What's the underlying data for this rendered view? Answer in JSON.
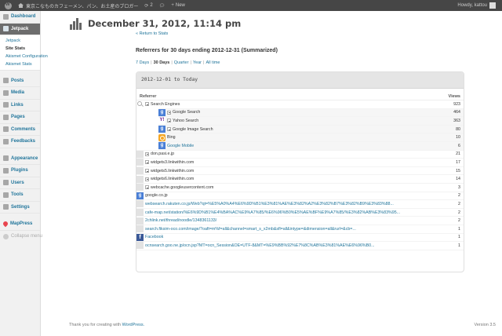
{
  "adminbar": {
    "site_name": "東京こなものカフェーメン、パン、お土産のブロガー",
    "updates_count": "2",
    "new_label": "New",
    "howdy": "Howdy, kattou"
  },
  "sidebar": {
    "items_top": [
      {
        "label": "Dashboard",
        "icon": "dashboard-icon"
      },
      {
        "label": "Jetpack",
        "icon": "jetpack-icon",
        "active": true
      }
    ],
    "submenu": [
      {
        "label": "Jetpack"
      },
      {
        "label": "Site Stats",
        "current": true
      },
      {
        "label": "Akismet Configuration"
      },
      {
        "label": "Akismet Stats"
      }
    ],
    "items_mid": [
      {
        "label": "Posts",
        "icon": "posts-icon"
      },
      {
        "label": "Media",
        "icon": "media-icon"
      },
      {
        "label": "Links",
        "icon": "links-icon"
      },
      {
        "label": "Pages",
        "icon": "pages-icon"
      },
      {
        "label": "Comments",
        "icon": "comments-icon"
      },
      {
        "label": "Feedbacks",
        "icon": "feedbacks-icon"
      }
    ],
    "items_low": [
      {
        "label": "Appearance",
        "icon": "appearance-icon"
      },
      {
        "label": "Plugins",
        "icon": "plugins-icon"
      },
      {
        "label": "Users",
        "icon": "users-icon"
      },
      {
        "label": "Tools",
        "icon": "tools-icon"
      },
      {
        "label": "Settings",
        "icon": "settings-icon"
      }
    ],
    "mappress": "MapPress",
    "collapse": "Collapse menu"
  },
  "page": {
    "title": "December 31, 2012, 11:14 pm",
    "return_link": "« Return to Stats",
    "section_title": "Referrers for 30 days ending 2012-12-31 (Summarized)",
    "ranges": [
      {
        "label": "7 Days",
        "current": false
      },
      {
        "label": "30 Days",
        "current": true
      },
      {
        "label": "Quarter",
        "current": false
      },
      {
        "label": "Year",
        "current": false
      },
      {
        "label": "All time",
        "current": false
      }
    ],
    "box_heading": "2012-12-01 to Today",
    "col_referrer": "Referrer",
    "col_views": "Views"
  },
  "rows": [
    {
      "type": "group",
      "icon": "search-icon",
      "label": "Search Engines",
      "views": "923"
    },
    {
      "type": "child",
      "icon": "google",
      "label": "Google Search",
      "views": "464"
    },
    {
      "type": "child",
      "icon": "yahoo",
      "label": "Yahoo Search",
      "views": "363"
    },
    {
      "type": "child",
      "icon": "google",
      "label": "Google Image Search",
      "views": "80"
    },
    {
      "type": "child-plain",
      "icon": "bing",
      "label": "Bing",
      "views": "10"
    },
    {
      "type": "child-plain",
      "icon": "google",
      "label": "Google Mobile",
      "views": "6"
    },
    {
      "type": "expand",
      "icon": "none",
      "label": "don.pasi.e.jp",
      "views": "21"
    },
    {
      "type": "expand",
      "icon": "none",
      "label": "widgets3.linkwithin.com",
      "views": "17"
    },
    {
      "type": "expand",
      "icon": "none",
      "label": "widgets5.linkwithin.com",
      "views": "15"
    },
    {
      "type": "expand",
      "icon": "none",
      "label": "widgets6.linkwithin.com",
      "views": "14"
    },
    {
      "type": "expand",
      "icon": "none",
      "label": "webcache.googleusercontent.com",
      "views": "3"
    },
    {
      "type": "plain",
      "icon": "google",
      "label": "google.co.jp",
      "views": "2"
    },
    {
      "type": "link",
      "icon": "none",
      "label": "websearch.rakuten.co.jp/Web?qt=%E5%A0%A4%E6%9D%B1%E3%81%AE%E3%82%A2%E3%82%B7%E3%82%B9%E3%83%88...",
      "views": "2"
    },
    {
      "type": "link",
      "icon": "none",
      "label": "cafe-map.net/station/%E6%9D%B1%E4%BA%AC%E9%A7%85/%E6%96%B0%E5%AE%BF%E9%A7%85/%E3%82%AB%E3%83%95...",
      "views": "2"
    },
    {
      "type": "link",
      "icon": "none",
      "label": "2chlink.net/thread/noodle/1348361133/",
      "views": "2"
    },
    {
      "type": "link",
      "icon": "none",
      "label": "search.fiksim-oco.com/image/?oaft=m%f=all&channel=smart_s_x2mb&sfl=all&intype=&dimension=all&rurl=&cb=...",
      "views": "1"
    },
    {
      "type": "link",
      "icon": "facebook",
      "label": "Facebook",
      "views": "1"
    },
    {
      "type": "link",
      "icon": "none",
      "label": "ocnsearch.goo.ne.jp/ocn.jsp?MT=ocn_Session&OE=UTF-8&MT=%E9%BB%92%E7%8C%AB%E3%81%AE%E6%96%B0...",
      "views": "1"
    }
  ],
  "footer": {
    "thanks_prefix": "Thank you for creating with",
    "wp_link": "WordPress.",
    "version": "Version 3.5"
  }
}
